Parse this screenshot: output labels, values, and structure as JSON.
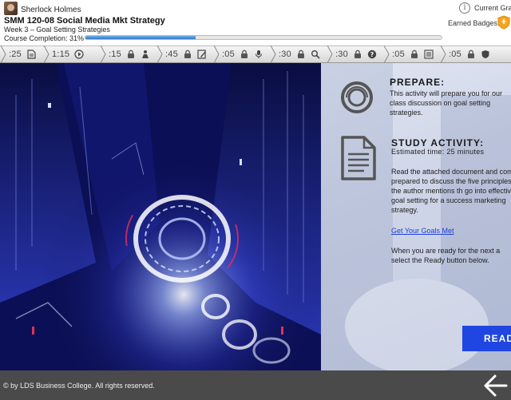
{
  "header": {
    "user_name": "Sherlock Holmes",
    "course_title": "SMM 120-08 Social Media Mkt Strategy",
    "week_label": "Week 3 – Goal Setting Strategies",
    "completion_label": "Course Completion: 31%",
    "completion_value": 0.31,
    "current_grade_label": "Current Gra",
    "badges_label": "Earned Badges:"
  },
  "timeline": [
    {
      "time": ":25",
      "icon": "document-icon",
      "locked": false
    },
    {
      "time": "1:15",
      "icon": "play-icon",
      "locked": false
    },
    {
      "time": ":15",
      "icon": "person-icon",
      "locked": true
    },
    {
      "time": ":45",
      "icon": "pencil-icon",
      "locked": true
    },
    {
      "time": ":05",
      "icon": "microphone-icon",
      "locked": true
    },
    {
      "time": ":30",
      "icon": "search-icon",
      "locked": true
    },
    {
      "time": ":30",
      "icon": "question-icon",
      "locked": true
    },
    {
      "time": ":05",
      "icon": "checklist-icon",
      "locked": true
    },
    {
      "time": ":05",
      "icon": "shield-icon",
      "locked": true
    }
  ],
  "prepare": {
    "title": "PREPARE:",
    "text": "This activity will prepare you for our class discussion on goal setting strategies."
  },
  "study": {
    "title": "STUDY ACTIVITY:",
    "time": "Estimated time: 25 minutes",
    "body": "Read the attached document and come prepared to discuss the five principles the author mentions th go into effective goal setting for a success marketing strategy.",
    "link": "Get Your Goals Met",
    "ready_text": "When you are ready for the next a select the Ready button below."
  },
  "ready_button": "READ",
  "footer": {
    "copyright": "© by LDS Business College. All rights reserved."
  },
  "colors": {
    "accent_blue": "#1f46e0",
    "progress_blue": "#2f78c4",
    "footer_bg": "#4a4a4a",
    "badge_orange": "#f4a623"
  }
}
